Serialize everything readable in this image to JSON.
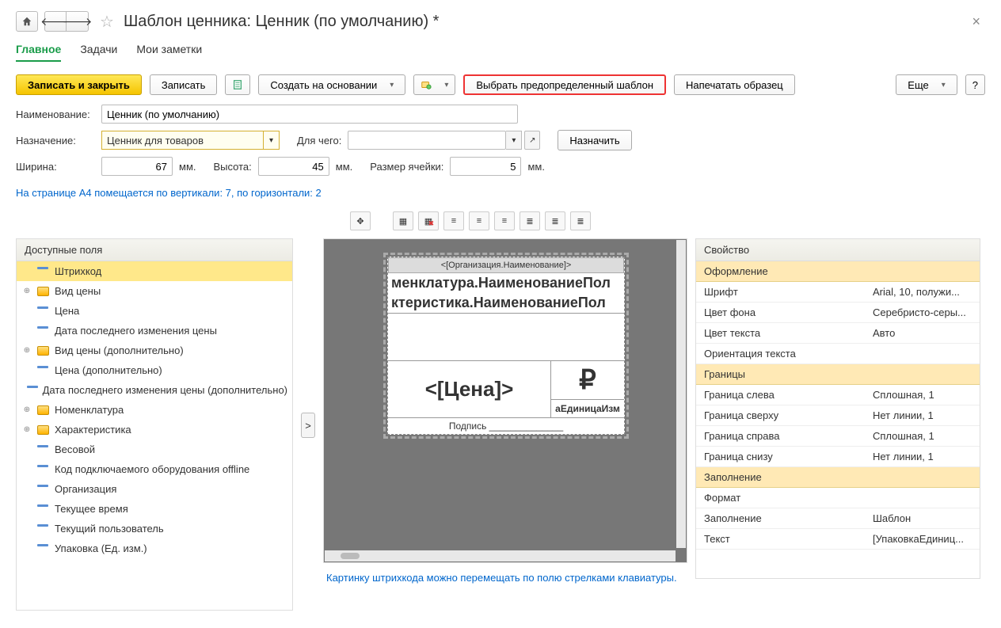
{
  "title": "Шаблон ценника: Ценник (по умолчанию) *",
  "tabs": [
    {
      "label": "Главное",
      "active": true
    },
    {
      "label": "Задачи",
      "active": false
    },
    {
      "label": "Мои заметки",
      "active": false
    }
  ],
  "toolbar": {
    "save_close": "Записать и закрыть",
    "save": "Записать",
    "create_based": "Создать на основании",
    "select_template": "Выбрать предопределенный шаблон",
    "print_sample": "Напечатать образец",
    "more": "Еще",
    "help": "?"
  },
  "form": {
    "name_label": "Наименование:",
    "name_value": "Ценник (по умолчанию)",
    "purpose_label": "Назначение:",
    "purpose_value": "Ценник для товаров",
    "forwhat_label": "Для чего:",
    "forwhat_value": "",
    "assign_btn": "Назначить",
    "width_label": "Ширина:",
    "width_value": "67",
    "height_label": "Высота:",
    "height_value": "45",
    "cell_label": "Размер ячейки:",
    "cell_value": "5",
    "unit_mm": "мм.",
    "fit_info": "На странице А4 помещается по вертикали: 7, по горизонтали: 2"
  },
  "tree_header": "Доступные поля",
  "tree": [
    {
      "label": "Штрихкод",
      "kind": "field",
      "expandable": false,
      "selected": true
    },
    {
      "label": "Вид цены",
      "kind": "folder",
      "expandable": true
    },
    {
      "label": "Цена",
      "kind": "field",
      "expandable": false
    },
    {
      "label": "Дата последнего изменения цены",
      "kind": "field",
      "expandable": false
    },
    {
      "label": "Вид цены (дополнительно)",
      "kind": "folder",
      "expandable": true
    },
    {
      "label": "Цена (дополнительно)",
      "kind": "field",
      "expandable": false
    },
    {
      "label": "Дата последнего изменения цены (дополнительно)",
      "kind": "field",
      "expandable": false
    },
    {
      "label": "Номенклатура",
      "kind": "folder",
      "expandable": true
    },
    {
      "label": "Характеристика",
      "kind": "folder",
      "expandable": true
    },
    {
      "label": "Весовой",
      "kind": "field",
      "expandable": false
    },
    {
      "label": "Код подключаемого оборудования offline",
      "kind": "field",
      "expandable": false
    },
    {
      "label": "Организация",
      "kind": "field",
      "expandable": false
    },
    {
      "label": "Текущее время",
      "kind": "field",
      "expandable": false
    },
    {
      "label": "Текущий пользователь",
      "kind": "field",
      "expandable": false
    },
    {
      "label": "Упаковка (Ед. изм.)",
      "kind": "field",
      "expandable": false
    }
  ],
  "canvas": {
    "org": "<[Организация.Наименование]>",
    "line1": "менклатура.НаименованиеПол",
    "line2": "ктеристика.НаименованиеПол",
    "price": "<[Цена]>",
    "ruble": "₽",
    "unit": "аЕдиницаИзм",
    "sign": "Подпись ______________",
    "hint": "Картинку штрихкода можно перемещать по полю стрелками клавиатуры."
  },
  "props_header": "Свойство",
  "props": {
    "sections": [
      {
        "title": "Оформление",
        "rows": [
          {
            "name": "Шрифт",
            "value": "Arial, 10, полужи..."
          },
          {
            "name": "Цвет фона",
            "value": "Серебристо-серы..."
          },
          {
            "name": "Цвет текста",
            "value": "Авто"
          },
          {
            "name": "Ориентация текста",
            "value": ""
          }
        ]
      },
      {
        "title": "Границы",
        "rows": [
          {
            "name": "Граница слева",
            "value": "Сплошная, 1"
          },
          {
            "name": "Граница сверху",
            "value": "Нет линии, 1"
          },
          {
            "name": "Граница справа",
            "value": "Сплошная, 1"
          },
          {
            "name": "Граница снизу",
            "value": "Нет линии, 1"
          }
        ]
      },
      {
        "title": "Заполнение",
        "rows": [
          {
            "name": "Формат",
            "value": ""
          },
          {
            "name": "Заполнение",
            "value": "Шаблон"
          },
          {
            "name": "Текст",
            "value": "[УпаковкаЕдиниц..."
          }
        ]
      }
    ]
  }
}
